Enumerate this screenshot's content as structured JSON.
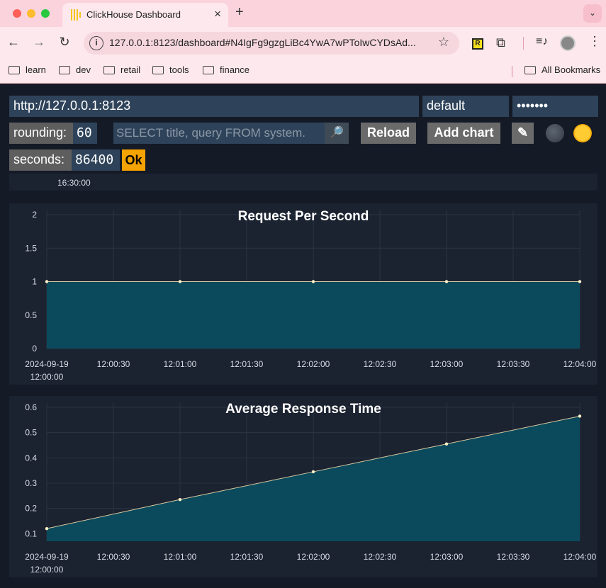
{
  "browser": {
    "tab_title": "ClickHouse Dashboard",
    "url": "127.0.0.1:8123/dashboard#N4IgFg9gzgLiBc4YwA7wPToIwCYDsAd...",
    "bookmarks": [
      "learn",
      "dev",
      "retail",
      "tools",
      "finance"
    ],
    "all_bookmarks": "All Bookmarks",
    "ext_r_label": "R"
  },
  "controls": {
    "url_value": "http://127.0.0.1:8123",
    "user_value": "default",
    "password_value": "•••••••",
    "rounding_label": "rounding:",
    "rounding_value": "60",
    "query_placeholder": "SELECT title, query FROM system.",
    "reload_label": "Reload",
    "add_chart_label": "Add chart",
    "edit_icon": "✎",
    "seconds_label": "seconds:",
    "seconds_value": "86400",
    "ok_label": "Ok"
  },
  "stub_tick": "16:30:00",
  "colors": {
    "fill": "#0a4a5c",
    "line": "#d8c8a0",
    "point": "#fff2c8",
    "grid": "#2a3444",
    "text": "#d8dde4"
  },
  "chart_data": [
    {
      "type": "area",
      "title": "Request Per Second",
      "x": [
        "2024-09-19 12:00:00",
        "2024-09-19 12:01:00",
        "2024-09-19 12:02:00",
        "2024-09-19 12:03:00",
        "2024-09-19 12:04:00"
      ],
      "values": [
        1,
        1,
        1,
        1,
        1
      ],
      "x_ticks": [
        "2024-09-19|12:00:00",
        "12:00:30",
        "12:01:00",
        "12:01:30",
        "12:02:00",
        "12:02:30",
        "12:03:00",
        "12:03:30",
        "12:04:00"
      ],
      "y_ticks": [
        "2",
        "1.5",
        "1",
        "0.5",
        "0"
      ],
      "ylim": [
        0,
        2
      ],
      "grid": true
    },
    {
      "type": "area",
      "title": "Average Response Time",
      "x": [
        "2024-09-19 12:00:00",
        "2024-09-19 12:01:00",
        "2024-09-19 12:02:00",
        "2024-09-19 12:03:00",
        "2024-09-19 12:04:00"
      ],
      "values": [
        0.12,
        0.235,
        0.345,
        0.455,
        0.565
      ],
      "x_ticks": [
        "2024-09-19|12:00:00",
        "12:00:30",
        "12:01:00",
        "12:01:30",
        "12:02:00",
        "12:02:30",
        "12:03:00",
        "12:03:30",
        "12:04:00"
      ],
      "y_ticks": [
        "0.6",
        "0.5",
        "0.4",
        "0.3",
        "0.2",
        "0.1"
      ],
      "ylim": [
        0.07,
        0.6
      ],
      "grid": true
    }
  ]
}
